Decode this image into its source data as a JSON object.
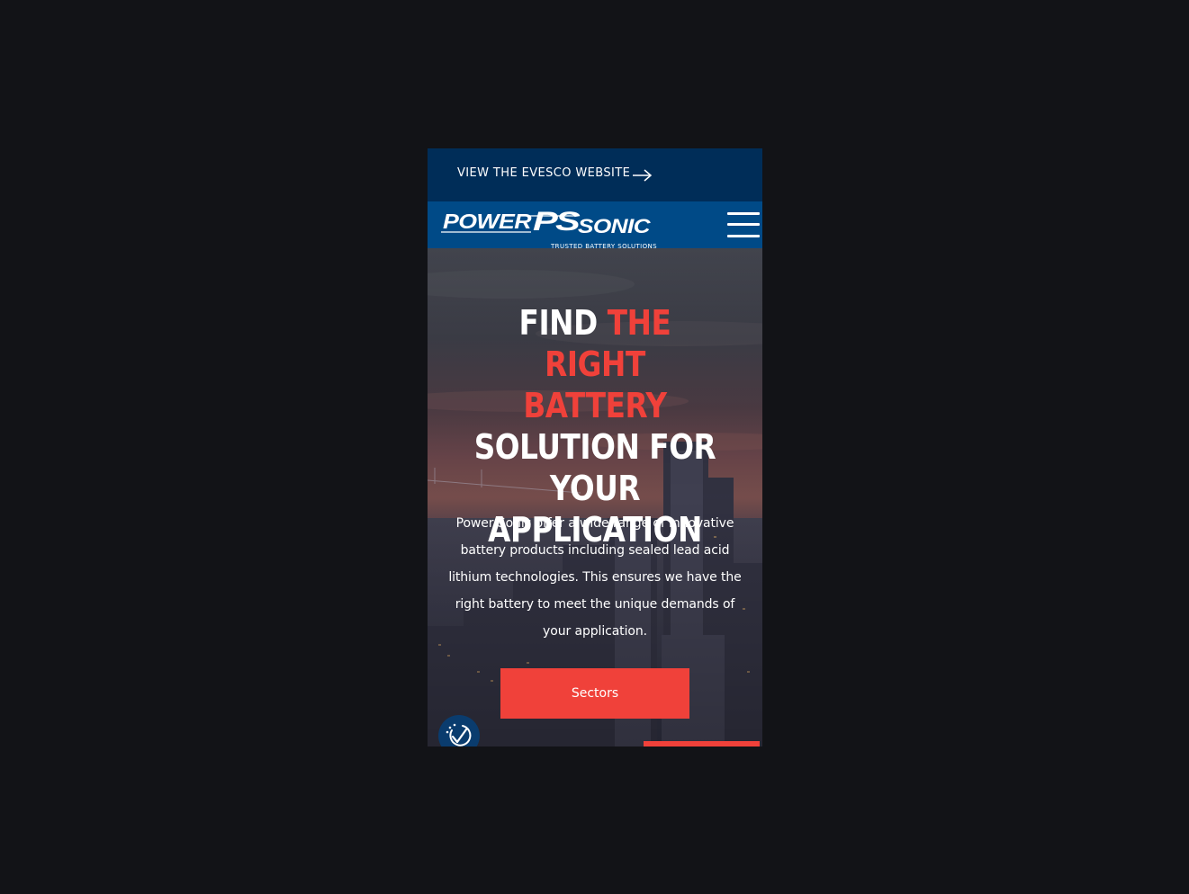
{
  "topbar": {
    "label": "VIEW THE EVESCO WEBSITE",
    "arrow_icon": "arrow-right-icon"
  },
  "header": {
    "logo_text": "POWERPSSONIC",
    "logo_tagline": "TRUSTED BATTERY SOLUTIONS",
    "menu_icon": "hamburger-menu-icon"
  },
  "hero": {
    "title_parts": {
      "p1": "FIND ",
      "p2": "THE RIGHT",
      "p3": "BATTERY",
      "p4": " SOLUTION FOR YOUR APPLICATION"
    },
    "description": "Power Sonic offer a wide range of innovative battery products including sealed lead acid lithium technologies. This ensures we have the right battery to meet the unique demands of your application.",
    "cta_label": "Sectors",
    "badge_icon": "checkmark-timer-icon"
  },
  "colors": {
    "page_background": "#121317",
    "topbar": "#002d58",
    "header": "#004a87",
    "accent": "#f0413a",
    "text": "#ffffff"
  }
}
